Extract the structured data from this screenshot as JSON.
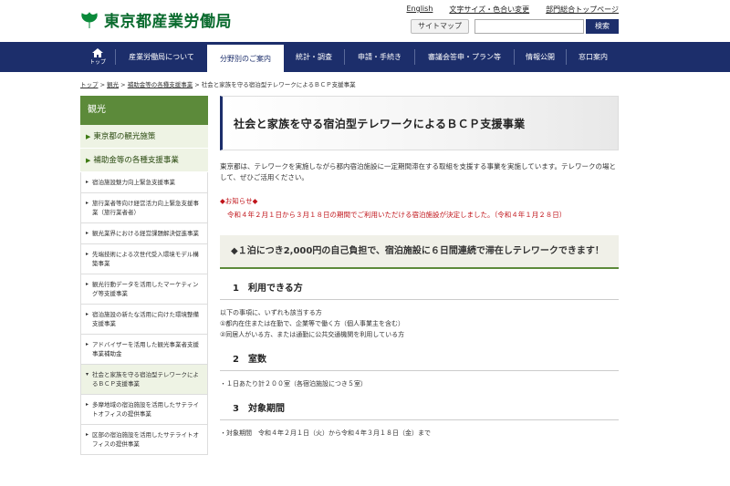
{
  "header": {
    "logo_text": "東京都産業労働局",
    "top_links": [
      "English",
      "文字サイズ・色合い変更",
      "部門総合トップページ"
    ],
    "sitemap_label": "サイトマップ",
    "search_placeholder": "",
    "search_button": "検索"
  },
  "nav": {
    "home_label": "トップ",
    "items": [
      "産業労働局について",
      "分野別のご案内",
      "統計・調査",
      "申請・手続き",
      "審議会答申・プラン等",
      "情報公開",
      "窓口案内"
    ],
    "active_index": 1
  },
  "breadcrumb": {
    "items": [
      "トップ",
      "観光",
      "補助金等の各種支援事業"
    ],
    "current": "社会と家族を守る宿泊型テレワークによるＢＣＰ支援事業"
  },
  "sidebar": {
    "title": "観光",
    "categories": [
      "東京都の観光施策",
      "補助金等の各種支援事業"
    ],
    "subitems": [
      "宿泊施設魅力向上緊急支援事業",
      "旅行業者等向け経営活力向上緊急支援事業（旅行業者者）",
      "観光業界における経営課題解決促進事業",
      "先端技術による次世代受入環境モデル構築事業",
      "観光行動データを活用したマーケティング等支援事業",
      "宿泊施設の新たな活用に向けた環境整備支援事業",
      "アドバイザーを活用した観光事業者支援事業補助金",
      "社会と家族を守る宿泊型テレワークによるＢＣＰ支援事業",
      "多摩地域の宿泊施設を活用したサテライトオフィスの提供事業",
      "区部の宿泊施設を活用したサテライトオフィスの提供事業"
    ],
    "active_sub_index": 7
  },
  "main": {
    "title": "社会と家族を守る宿泊型テレワークによるＢＣＰ支援事業",
    "intro": "東京都は、テレワークを実施しながら都内宿泊施設に一定期間滞在する取組を支援する事業を実施しています。テレワークの場として、ぜひご活用ください。",
    "notice_head": "◆お知らせ◆",
    "notice_body": "令和４年２月１日から３月１８日の期間でご利用いただける宿泊施設が決定しました。（令和４年１月２８日）",
    "highlight": "◆１泊につき2,000円の自己負担で、宿泊施設に６日間連続で滞在しテレワークできます！",
    "sections": [
      {
        "heading": "1　利用できる方",
        "lines": [
          "以下の事項に、いずれも該当する方",
          "①都内在住または在勤で、企業等で働く方（個人事業主を含む）",
          "②同居人がいる方、または通勤に公共交通機関を利用している方"
        ]
      },
      {
        "heading": "2　室数",
        "lines": [
          "・１日あたり計２００室（各宿泊施設につき５室）"
        ]
      },
      {
        "heading": "3　対象期間",
        "lines": [
          "・対象期間　令和４年２月１日（火）から令和４年３月１８日（金）まで"
        ]
      }
    ]
  }
}
